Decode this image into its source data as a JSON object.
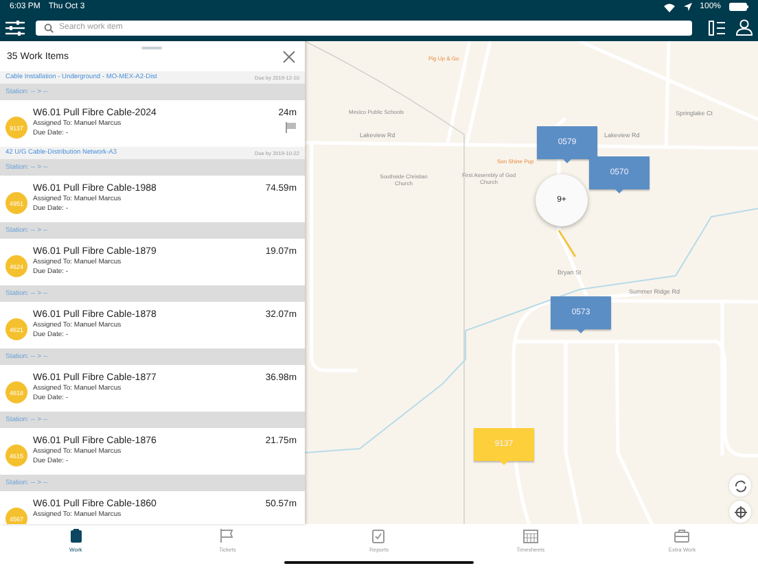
{
  "status_bar": {
    "time": "6:03 PM",
    "date": "Thu Oct 3",
    "battery": "100%"
  },
  "search": {
    "placeholder": "Search work item"
  },
  "list": {
    "title": "35 Work Items",
    "rows": [
      {
        "kind": "group",
        "title": "Cable Installation - Underground - MO-MEX-A2-Dist",
        "due": "Due by 2019-12-10"
      },
      {
        "kind": "station",
        "label": "Station: -- > --"
      },
      {
        "kind": "item",
        "badge": "9137",
        "title": "W6.01 Pull Fibre Cable-2024",
        "assigned": "Assigned To: Manuel Marcus",
        "due": "Due Date: -",
        "length": "24m",
        "flagged": true
      },
      {
        "kind": "group",
        "title": "42 U/G Cable-Distribution Network-A3",
        "due": "Due by 2019-10-22"
      },
      {
        "kind": "station",
        "label": "Station: -- > --"
      },
      {
        "kind": "item",
        "badge": "4951",
        "title": "W6.01 Pull Fibre Cable-1988",
        "assigned": "Assigned To: Manuel Marcus",
        "due": "Due Date: -",
        "length": "74.59m",
        "flagged": false
      },
      {
        "kind": "station",
        "label": "Station: -- > --"
      },
      {
        "kind": "item",
        "badge": "4624",
        "title": "W6.01 Pull Fibre Cable-1879",
        "assigned": "Assigned To: Manuel Marcus",
        "due": "Due Date: -",
        "length": "19.07m",
        "flagged": false
      },
      {
        "kind": "station",
        "label": "Station: -- > --"
      },
      {
        "kind": "item",
        "badge": "4621",
        "title": "W6.01 Pull Fibre Cable-1878",
        "assigned": "Assigned To: Manuel Marcus",
        "due": "Due Date: -",
        "length": "32.07m",
        "flagged": false
      },
      {
        "kind": "station",
        "label": "Station: -- > --"
      },
      {
        "kind": "item",
        "badge": "4618",
        "title": "W6.01 Pull Fibre Cable-1877",
        "assigned": "Assigned To: Manuel Marcus",
        "due": "Due Date: -",
        "length": "36.98m",
        "flagged": false
      },
      {
        "kind": "station",
        "label": "Station: -- > --"
      },
      {
        "kind": "item",
        "badge": "4615",
        "title": "W6.01 Pull Fibre Cable-1876",
        "assigned": "Assigned To: Manuel Marcus",
        "due": "Due Date: -",
        "length": "21.75m",
        "flagged": false
      },
      {
        "kind": "station",
        "label": "Station: -- > --"
      },
      {
        "kind": "item",
        "badge": "4567",
        "title": "W6.01 Pull Fibre Cable-1860",
        "assigned": "Assigned To: Manuel Marcus",
        "length": "50.57m",
        "flagged": false
      }
    ]
  },
  "map": {
    "places": [
      {
        "kind": "business",
        "label": "Pig Up & Go"
      },
      {
        "kind": "poi",
        "label": "Mexico Public Schools"
      },
      {
        "kind": "poi",
        "label": "Southside Christian Church"
      },
      {
        "kind": "poi",
        "label": "First Assembly of God Church"
      },
      {
        "kind": "business",
        "label": "Son Shine Pup"
      },
      {
        "kind": "road",
        "label": "Lakeview Rd"
      },
      {
        "kind": "road",
        "label": "Lakeview Rd"
      },
      {
        "kind": "road",
        "label": "Springlake Ct"
      },
      {
        "kind": "road",
        "label": "Bryan St"
      },
      {
        "kind": "road",
        "label": "Summer Ridge Rd"
      }
    ],
    "markers": [
      {
        "kind": "pin",
        "label": "0579",
        "color": "#5b8ec4"
      },
      {
        "kind": "pin",
        "label": "0570",
        "color": "#5b8ec4"
      },
      {
        "kind": "cluster",
        "label": "9+"
      },
      {
        "kind": "pin",
        "label": "0573",
        "color": "#5b8ec4"
      },
      {
        "kind": "pin",
        "label": "9137",
        "color": "#fdd03b"
      }
    ]
  },
  "tabs": [
    {
      "label": "Work",
      "selected": true
    },
    {
      "label": "Tickets",
      "selected": false
    },
    {
      "label": "Reports",
      "selected": false
    },
    {
      "label": "Timesheets",
      "selected": false
    },
    {
      "label": "Extra Work",
      "selected": false
    }
  ]
}
